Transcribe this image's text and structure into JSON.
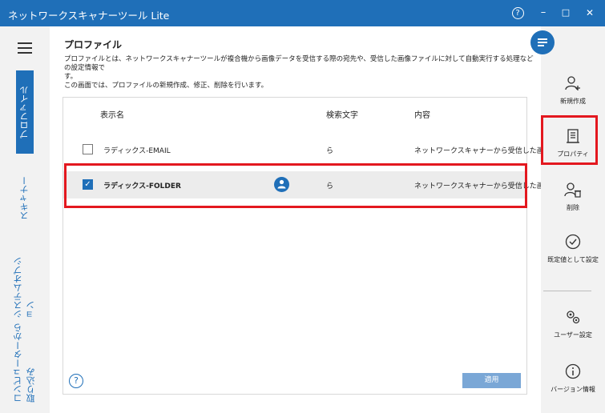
{
  "window": {
    "title": "ネットワークスキャナーツール Lite",
    "help_glyph": "?",
    "minimize_glyph": "–",
    "maximize_glyph": "□",
    "close_glyph": "✕"
  },
  "sidebar": {
    "tabs": [
      {
        "label": "プロファイル",
        "active": true
      },
      {
        "label": "スキャナー",
        "active": false
      },
      {
        "label": "システムオプション",
        "active": false
      },
      {
        "label": "コンピューターから取り込み",
        "active": false
      }
    ]
  },
  "main": {
    "title": "プロファイル",
    "description_line1": "プロファイルとは、ネットワークスキャナーツールが複合機から画像データを受信する際の宛先や、受信した画像ファイルに対して自動実行する処理などの設定情報で",
    "description_line2": "す。",
    "description_line3": "この画面では、プロファイルの新規作成、修正、削除を行います。",
    "table": {
      "columns": [
        "表示名",
        "検索文字",
        "内容"
      ],
      "rows": [
        {
          "name": "ラディックス-EMAIL",
          "search": "ら",
          "content": "ネットワークスキャナーから受信した画…",
          "checked": false
        },
        {
          "name": "ラディックス-FOLDER",
          "search": "ら",
          "content": "ネットワークスキャナーから受信した画…",
          "checked": true
        }
      ]
    },
    "help_glyph": "?",
    "apply_label": "適用"
  },
  "actions": [
    {
      "label": "新規作成",
      "icon": "add-user-icon"
    },
    {
      "label": "プロパティ",
      "icon": "properties-icon"
    },
    {
      "label": "削除",
      "icon": "delete-user-icon"
    },
    {
      "label": "既定値として設定",
      "icon": "check-circle-icon"
    },
    {
      "label": "ユーザー設定",
      "icon": "gears-icon"
    },
    {
      "label": "バージョン情報",
      "icon": "info-icon"
    }
  ],
  "colors": {
    "accent": "#1f6fb8",
    "highlight": "#e3181f"
  }
}
